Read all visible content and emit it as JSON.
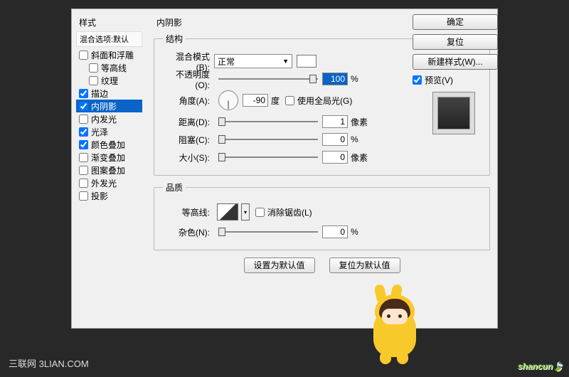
{
  "sidebar": {
    "title": "样式",
    "subtitle": "混合选项:默认",
    "items": [
      {
        "label": "斜面和浮雕",
        "checked": false,
        "indent": false
      },
      {
        "label": "等高线",
        "checked": false,
        "indent": true
      },
      {
        "label": "纹理",
        "checked": false,
        "indent": true
      },
      {
        "label": "描边",
        "checked": true,
        "indent": false
      },
      {
        "label": "内阴影",
        "checked": true,
        "indent": false,
        "selected": true
      },
      {
        "label": "内发光",
        "checked": false,
        "indent": false
      },
      {
        "label": "光泽",
        "checked": true,
        "indent": false
      },
      {
        "label": "颜色叠加",
        "checked": true,
        "indent": false
      },
      {
        "label": "渐变叠加",
        "checked": false,
        "indent": false
      },
      {
        "label": "图案叠加",
        "checked": false,
        "indent": false
      },
      {
        "label": "外发光",
        "checked": false,
        "indent": false
      },
      {
        "label": "投影",
        "checked": false,
        "indent": false
      }
    ]
  },
  "panel": {
    "title": "内阴影",
    "structure_legend": "结构",
    "blend_label": "混合模式(B):",
    "blend_value": "正常",
    "opacity_label": "不透明度(O):",
    "opacity_value": "100",
    "opacity_unit": "%",
    "angle_label": "角度(A):",
    "angle_value": "-90",
    "angle_unit": "度",
    "global_light": "使用全局光(G)",
    "distance_label": "距离(D):",
    "distance_value": "1",
    "distance_unit": "像素",
    "choke_label": "阻塞(C):",
    "choke_value": "0",
    "choke_unit": "%",
    "size_label": "大小(S):",
    "size_value": "0",
    "size_unit": "像素",
    "quality_legend": "品质",
    "contour_label": "等高线:",
    "antialias": "消除锯齿(L)",
    "noise_label": "杂色(N):",
    "noise_value": "0",
    "noise_unit": "%",
    "set_default": "设置为默认值",
    "reset_default": "复位为默认值"
  },
  "buttons": {
    "ok": "确定",
    "cancel": "复位",
    "new_style": "新建样式(W)...",
    "preview": "预览(V)"
  },
  "footer": "三联网 3LIAN.COM",
  "watermark": "shancun"
}
